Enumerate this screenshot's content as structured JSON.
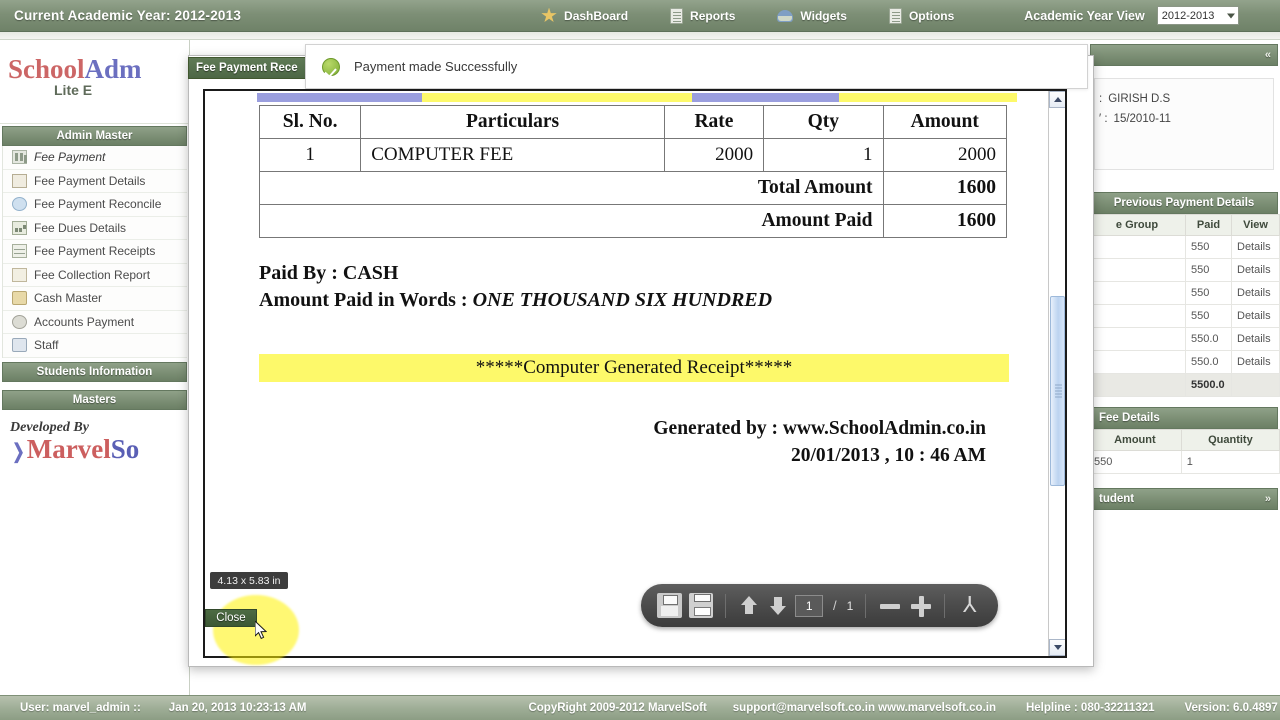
{
  "topbar": {
    "academic_year_text": "Current Academic Year: 2012-2013",
    "nav": [
      {
        "label": "DashBoard",
        "icon": "star-icon"
      },
      {
        "label": "Reports",
        "icon": "document-icon"
      },
      {
        "label": "Widgets",
        "icon": "widget-icon"
      },
      {
        "label": "Options",
        "icon": "document-icon"
      }
    ],
    "academic_year_view_label": "Academic Year View",
    "year_selected": "2012-2013"
  },
  "sidebar": {
    "logo": {
      "part1": "School",
      "part2": "Adm",
      "sub": "Lite E"
    },
    "groups": [
      {
        "label": "Admin Master"
      },
      {
        "label": "Students Information"
      },
      {
        "label": "Masters"
      }
    ],
    "items": [
      {
        "label": "Fee Payment",
        "icon": "bars-icon",
        "active": true
      },
      {
        "label": "Fee Payment Details",
        "icon": "page-icon",
        "active": false
      },
      {
        "label": "Fee Payment Reconcile",
        "icon": "cycle-icon",
        "active": false
      },
      {
        "label": "Fee Dues Details",
        "icon": "chart-icon",
        "active": false
      },
      {
        "label": "Fee Payment Receipts",
        "icon": "grid-icon",
        "active": false
      },
      {
        "label": "Fee Collection Report",
        "icon": "bar-chart-icon",
        "active": false
      },
      {
        "label": "Cash Master",
        "icon": "briefcase-icon",
        "active": false
      },
      {
        "label": "Accounts Payment",
        "icon": "gears-icon",
        "active": false
      },
      {
        "label": "Staff",
        "icon": "staff-icon",
        "active": false
      }
    ],
    "developed_by": "Developed By",
    "marvel": {
      "red": "Marvel",
      "blue": "So"
    }
  },
  "toast": {
    "message": "Payment made Successfully",
    "icon": "success-check-icon"
  },
  "modal": {
    "tab_title": "Fee Payment Rece",
    "close_label": "Close",
    "size_tooltip": "4.13 x 5.83 in"
  },
  "receipt": {
    "columns": [
      "Sl. No.",
      "Particulars",
      "Rate",
      "Qty",
      "Amount"
    ],
    "rows": [
      {
        "sl": "1",
        "particulars": "COMPUTER FEE",
        "rate": "2000",
        "qty": "1",
        "amount": "2000"
      }
    ],
    "total_label": "Total Amount",
    "total_value": "1600",
    "paid_label": "Amount Paid",
    "paid_value": "1600",
    "paid_by_label": "Paid By : ",
    "paid_by_value": "CASH",
    "words_label": "Amount Paid in Words : ",
    "words_value": "ONE THOUSAND SIX HUNDRED",
    "computer_generated": "*****Computer Generated Receipt*****",
    "generated_by": "Generated by : www.SchoolAdmin.co.in",
    "generated_at": "20/01/2013 , 10 : 46 AM",
    "highlight_blue": "#9a9ede",
    "highlight_yellow": "#fdf96a"
  },
  "pdf_toolbar": {
    "save_icon": "save-icon",
    "print_icon": "print-icon",
    "prev_icon": "arrow-up-icon",
    "next_icon": "arrow-down-icon",
    "current_page": "1",
    "page_separator": "/",
    "total_pages": "1",
    "zoom_out_icon": "minus-icon",
    "zoom_in_icon": "plus-icon",
    "acrobat_icon": "acrobat-icon",
    "acrobat_glyph": "⅄"
  },
  "rightpanel": {
    "top_header": "",
    "student_name_key": ":",
    "student_name": "GIRISH D.S",
    "reg_key": "′ :",
    "reg_value": "15/2010-11",
    "previous_payment_header": "Previous Payment Details",
    "prev_columns": [
      "e Group",
      "Paid",
      "View"
    ],
    "prev_rows": [
      {
        "paid": "550",
        "view": "Details"
      },
      {
        "paid": "550",
        "view": "Details"
      },
      {
        "paid": "550",
        "view": "Details"
      },
      {
        "paid": "550",
        "view": "Details"
      },
      {
        "paid": "550.0",
        "view": "Details"
      },
      {
        "paid": "550.0",
        "view": "Details"
      }
    ],
    "prev_total": "5500.0",
    "fee_details_header": "Fee Details",
    "fee_columns": [
      "Amount",
      "Quantity"
    ],
    "fee_rows": [
      {
        "amount": "550",
        "quantity": "1"
      }
    ],
    "student_header": "tudent"
  },
  "footer": {
    "user": "User: marvel_admin ::",
    "datetime": "Jan 20, 2013 10:23:13 AM",
    "copyright": "CopyRight 2009-2012 MarvelSoft",
    "support": "support@marvelsoft.co.in www.marvelsoft.co.in",
    "helpline": "Helpline : 080-32211321",
    "version": "Version: 6.0.4897"
  }
}
